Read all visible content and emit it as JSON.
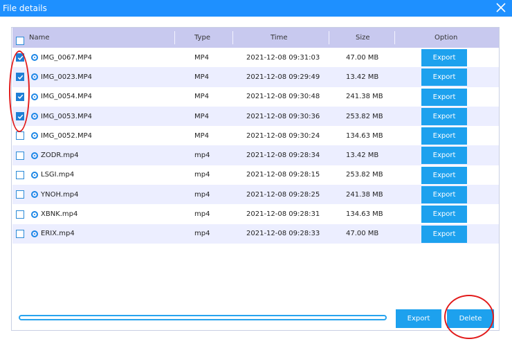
{
  "window": {
    "title": "File details"
  },
  "table": {
    "headers": {
      "name": "Name",
      "type": "Type",
      "time": "Time",
      "size": "Size",
      "option": "Option"
    },
    "select_all_checked": false,
    "rows": [
      {
        "checked": true,
        "name": "IMG_0067.MP4",
        "type": "MP4",
        "time": "2021-12-08 09:31:03",
        "size": "47.00 MB",
        "action": "Export"
      },
      {
        "checked": true,
        "name": "IMG_0023.MP4",
        "type": "MP4",
        "time": "2021-12-08 09:29:49",
        "size": "13.42 MB",
        "action": "Export"
      },
      {
        "checked": true,
        "name": "IMG_0054.MP4",
        "type": "MP4",
        "time": "2021-12-08 09:30:48",
        "size": "241.38 MB",
        "action": "Export"
      },
      {
        "checked": true,
        "name": "IMG_0053.MP4",
        "type": "MP4",
        "time": "2021-12-08 09:30:36",
        "size": "253.82 MB",
        "action": "Export"
      },
      {
        "checked": false,
        "name": "IMG_0052.MP4",
        "type": "MP4",
        "time": "2021-12-08 09:30:24",
        "size": "134.63 MB",
        "action": "Export"
      },
      {
        "checked": false,
        "name": "ZODR.mp4",
        "type": "mp4",
        "time": "2021-12-08 09:28:34",
        "size": "13.42 MB",
        "action": "Export"
      },
      {
        "checked": false,
        "name": "LSGI.mp4",
        "type": "mp4",
        "time": "2021-12-08 09:28:15",
        "size": "253.82 MB",
        "action": "Export"
      },
      {
        "checked": false,
        "name": "YNOH.mp4",
        "type": "mp4",
        "time": "2021-12-08 09:28:25",
        "size": "241.38 MB",
        "action": "Export"
      },
      {
        "checked": false,
        "name": "XBNK.mp4",
        "type": "mp4",
        "time": "2021-12-08 09:28:31",
        "size": "134.63 MB",
        "action": "Export"
      },
      {
        "checked": false,
        "name": "ERIX.mp4",
        "type": "mp4",
        "time": "2021-12-08 09:28:33",
        "size": "47.00 MB",
        "action": "Export"
      }
    ]
  },
  "footer": {
    "progress_fraction": 0,
    "export_label": "Export",
    "delete_label": "Delete"
  },
  "icons": {
    "close": "close-icon",
    "file": "video-file-icon",
    "check": "check-icon"
  },
  "colors": {
    "accent": "#1da1ee",
    "titlebar": "#1e90ff",
    "header_bg": "#c8c9ef",
    "alt_row_bg": "#eceeff",
    "annotation": "#e21a1a"
  }
}
